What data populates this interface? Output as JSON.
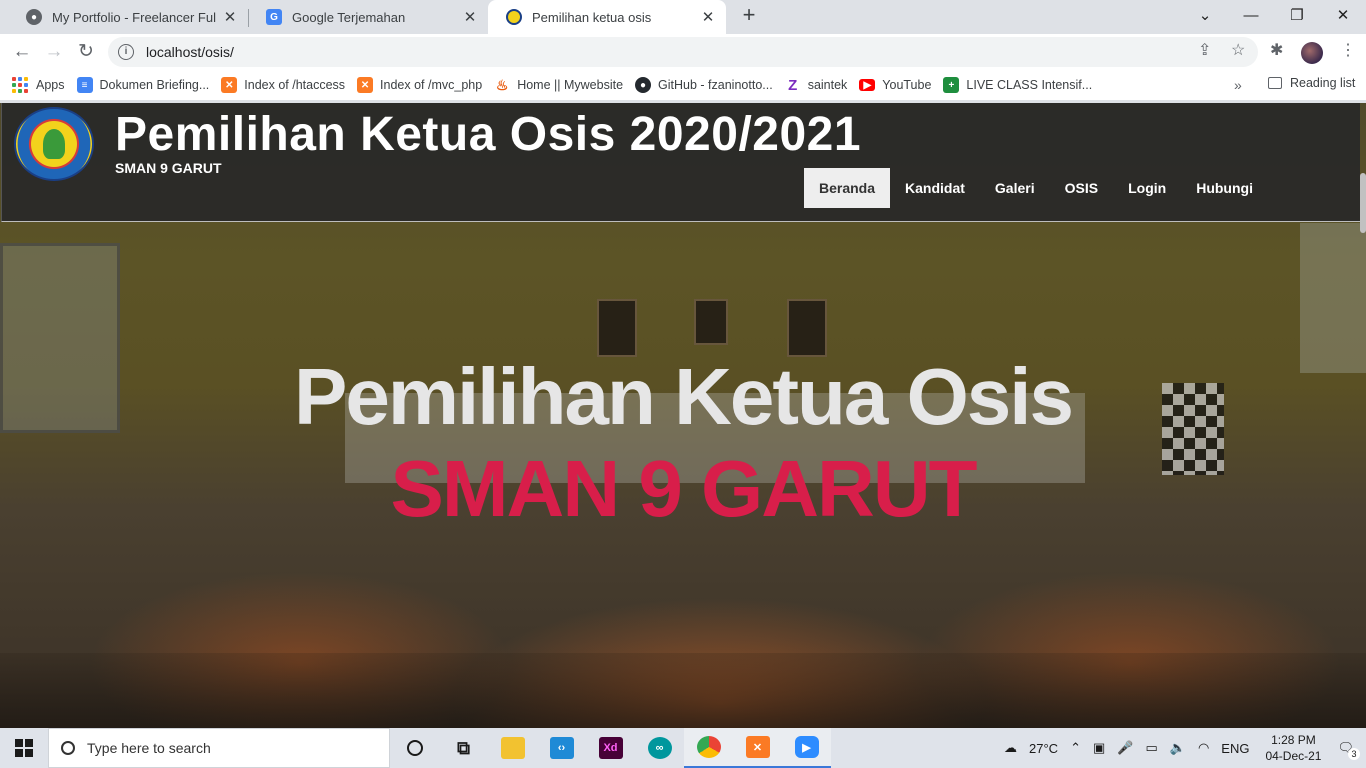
{
  "browser": {
    "tabs": [
      {
        "title": "My Portfolio - Freelancer FullStac",
        "icon": "globe-icon",
        "active": false
      },
      {
        "title": "Google Terjemahan",
        "icon": "google-translate-icon",
        "active": false
      },
      {
        "title": "Pemilihan ketua osis",
        "icon": "school-logo-icon",
        "active": true
      }
    ],
    "close_glyph": "✕",
    "new_tab_glyph": "+",
    "url": "localhost/osis/",
    "bookmarks": [
      {
        "label": "Apps",
        "icon": "apps-grid-icon"
      },
      {
        "label": "Dokumen Briefing...",
        "icon": "docs-icon",
        "color": "#4285f4"
      },
      {
        "label": "Index of /htaccess",
        "icon": "xampp-icon",
        "color": "#fb7a24"
      },
      {
        "label": "Index of /mvc_php",
        "icon": "xampp-icon",
        "color": "#fb7a24"
      },
      {
        "label": "Home || Mywebsite",
        "icon": "flame-icon",
        "color": "#e8590c"
      },
      {
        "label": "GitHub - fzaninotto...",
        "icon": "github-icon",
        "color": "#24292e"
      },
      {
        "label": "saintek",
        "icon": "z-icon",
        "color": "#7b2cbf"
      },
      {
        "label": "YouTube",
        "icon": "youtube-icon",
        "color": "#ff0000"
      },
      {
        "label": "LIVE CLASS Intensif...",
        "icon": "classroom-icon",
        "color": "#1e8e3e"
      }
    ],
    "more_glyph": "»",
    "reading_list": "Reading list"
  },
  "site": {
    "title": "Pemilihan Ketua Osis 2020/2021",
    "subtitle": "SMAN 9 GARUT",
    "nav": [
      {
        "label": "Beranda",
        "active": true
      },
      {
        "label": "Kandidat",
        "active": false
      },
      {
        "label": "Galeri",
        "active": false
      },
      {
        "label": "OSIS",
        "active": false
      },
      {
        "label": "Login",
        "active": false
      },
      {
        "label": "Hubungi",
        "active": false
      }
    ],
    "hero": {
      "line1": "Pemilihan Ketua Osis",
      "line2": "SMAN 9 GARUT",
      "accent": "#d81e4a"
    }
  },
  "taskbar": {
    "search_placeholder": "Type here to search",
    "apps": [
      "cortana-icon",
      "task-view-icon",
      "file-explorer-icon",
      "vscode-icon",
      "adobe-xd-icon",
      "arduino-icon",
      "chrome-icon",
      "xampp-icon",
      "zoom-icon"
    ],
    "weather": "27°C",
    "language": "ENG",
    "time": "1:28 PM",
    "date": "04-Dec-21",
    "notifications": "3"
  }
}
